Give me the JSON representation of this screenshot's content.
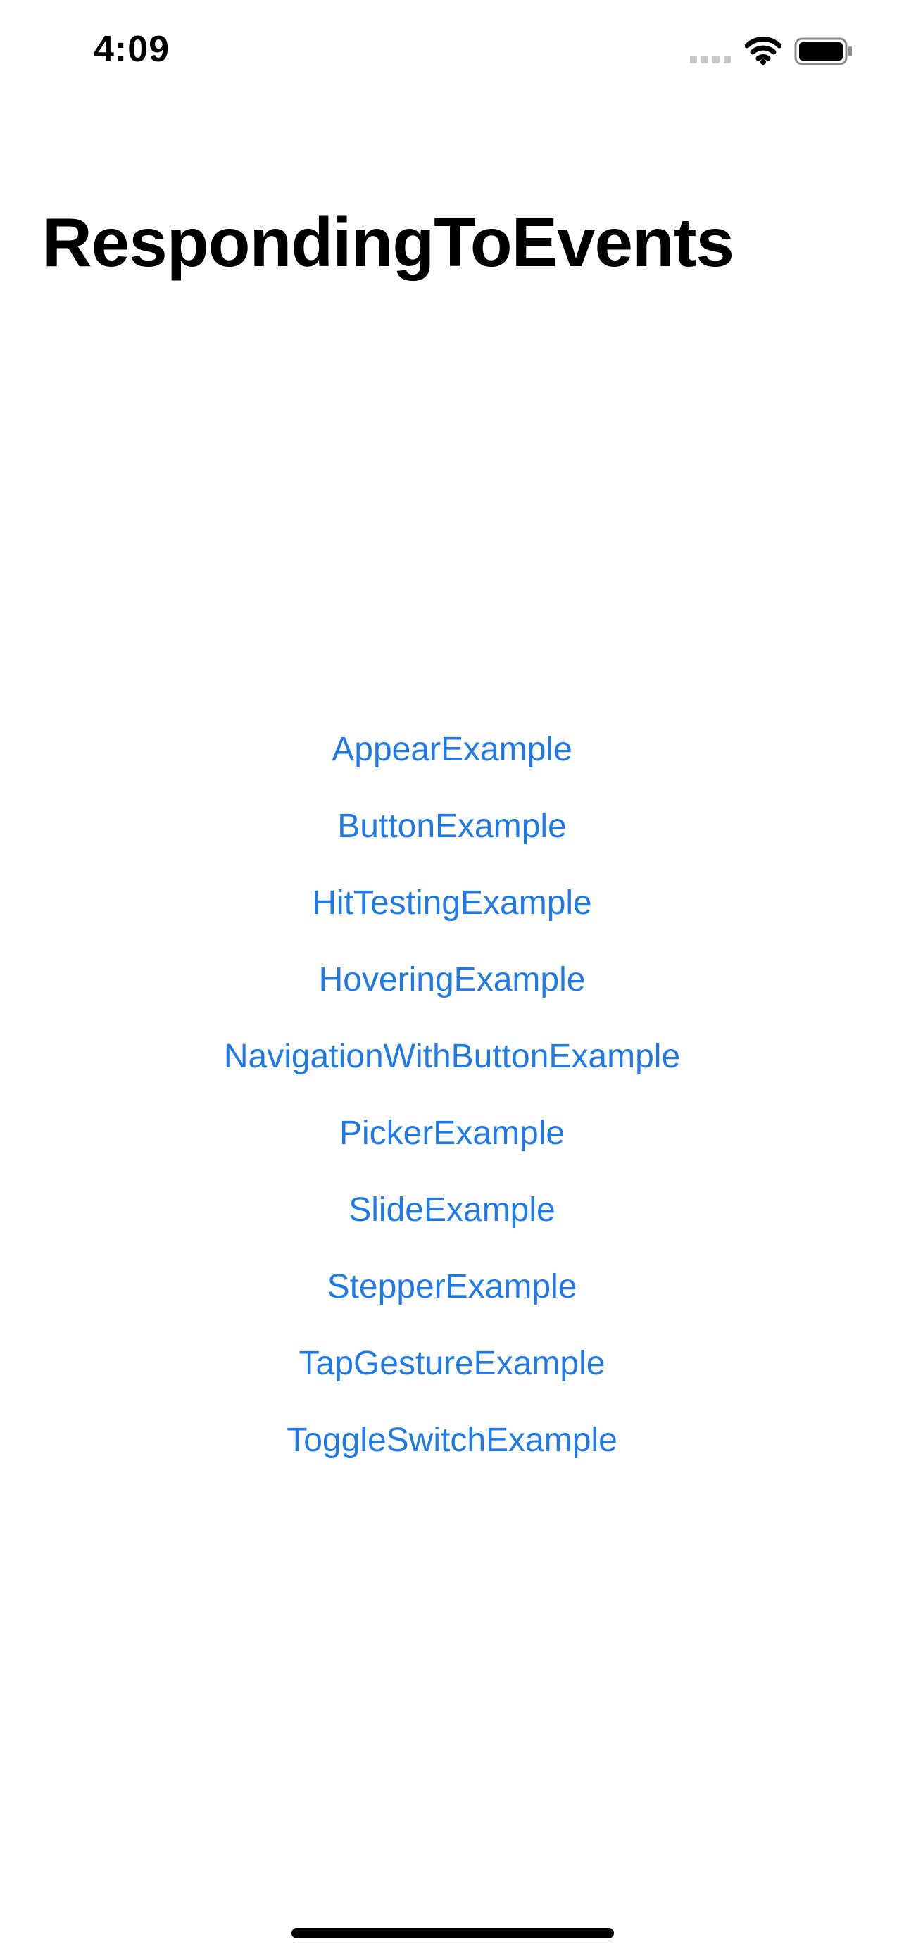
{
  "status_bar": {
    "time": "4:09",
    "icons": [
      "signal-icon",
      "wifi-icon",
      "battery-icon"
    ]
  },
  "nav": {
    "title": "RespondingToEvents"
  },
  "links": [
    "AppearExample",
    "ButtonExample",
    "HitTestingExample",
    "HoveringExample",
    "NavigationWithButtonExample",
    "PickerExample",
    "SlideExample",
    "StepperExample",
    "TapGestureExample",
    "ToggleSwitchExample"
  ],
  "colors": {
    "link": "#1f7ae8",
    "text": "#000000",
    "background": "#ffffff"
  }
}
